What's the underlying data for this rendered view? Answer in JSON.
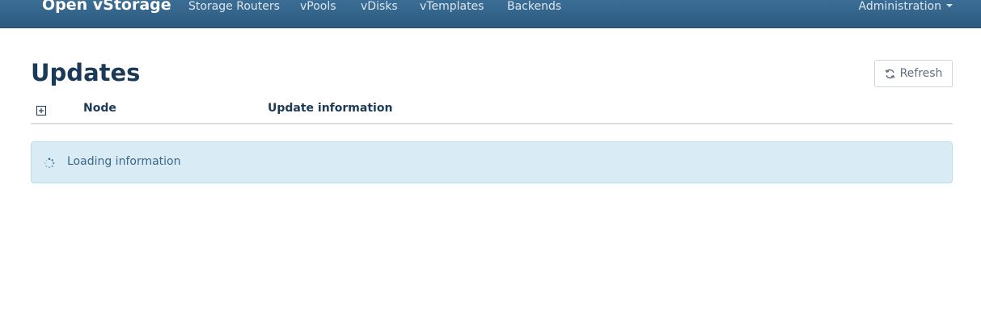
{
  "navbar": {
    "brand": "Open vStorage",
    "links": [
      "Storage Routers",
      "vPools",
      "vDisks",
      "vTemplates",
      "Backends"
    ],
    "admin_label": "Administration"
  },
  "page": {
    "title": "Updates",
    "refresh_label": "Refresh"
  },
  "table": {
    "columns": [
      "Node",
      "Update information"
    ]
  },
  "status": {
    "loading_text": "Loading information"
  },
  "icons": {
    "refresh": "refresh-icon",
    "expand": "expand-all-icon",
    "spinner": "spinner-icon",
    "dropdown": "caret-down-icon"
  },
  "colors": {
    "navbar": "#2f5f86",
    "title": "#1b3a57",
    "alert_bg": "#d9ecf6",
    "alert_text": "#3d6688"
  }
}
